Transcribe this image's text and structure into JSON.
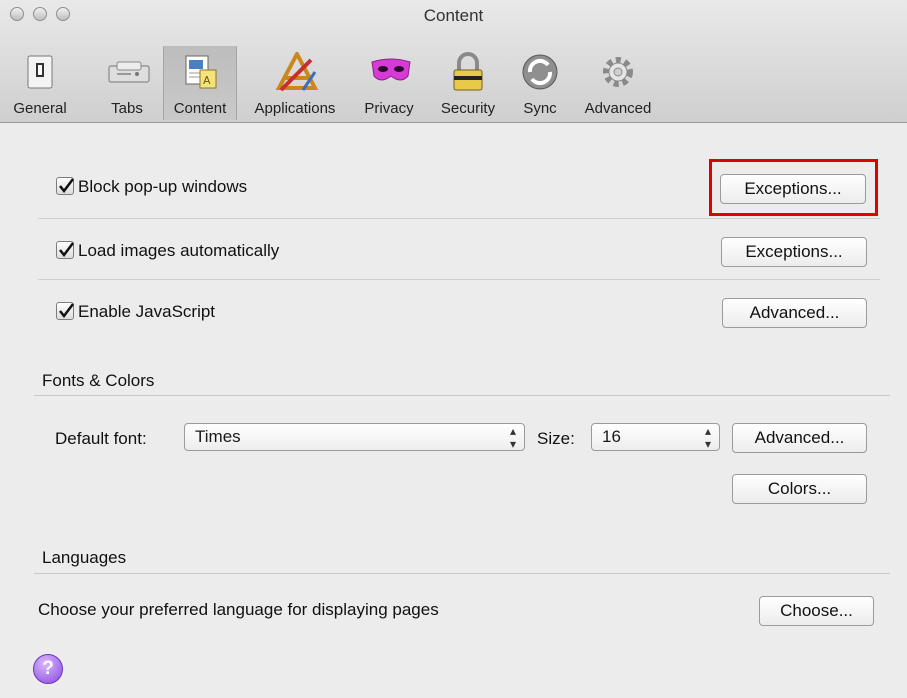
{
  "window": {
    "title": "Content"
  },
  "toolbar": {
    "items": [
      {
        "label": "General",
        "icon": "switch-icon"
      },
      {
        "label": "Tabs",
        "icon": "tabs-icon"
      },
      {
        "label": "Content",
        "icon": "content-icon",
        "selected": true
      },
      {
        "label": "Applications",
        "icon": "applications-icon"
      },
      {
        "label": "Privacy",
        "icon": "mask-icon"
      },
      {
        "label": "Security",
        "icon": "padlock-icon"
      },
      {
        "label": "Sync",
        "icon": "sync-icon"
      },
      {
        "label": "Advanced",
        "icon": "gear-icon"
      }
    ]
  },
  "content": {
    "block_popups": {
      "label": "Block pop-up windows",
      "checked": true,
      "button": "Exceptions..."
    },
    "load_images": {
      "label": "Load images automatically",
      "checked": true,
      "button": "Exceptions..."
    },
    "enable_js": {
      "label": "Enable JavaScript",
      "checked": true,
      "button": "Advanced..."
    }
  },
  "fonts_colors": {
    "title": "Fonts & Colors",
    "default_font_label": "Default font:",
    "default_font_value": "Times",
    "size_label": "Size:",
    "size_value": "16",
    "advanced_button": "Advanced...",
    "colors_button": "Colors..."
  },
  "languages": {
    "title": "Languages",
    "description": "Choose your preferred language for displaying pages",
    "choose_button": "Choose..."
  },
  "help": {
    "symbol": "?"
  },
  "colors": {
    "highlight": "#e00000",
    "help": "#8a47e0"
  }
}
